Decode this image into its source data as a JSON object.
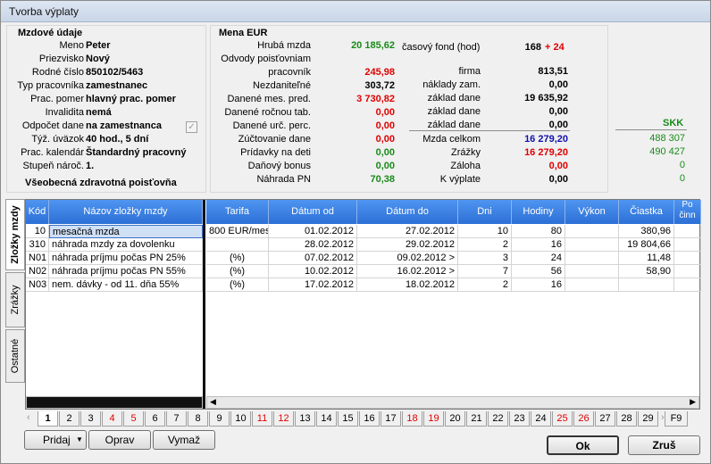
{
  "window": {
    "title": "Tvorba výplaty"
  },
  "employee": {
    "section_title": "Mzdové údaje",
    "rows": [
      {
        "label": "Meno",
        "value": "Peter"
      },
      {
        "label": "Priezvisko",
        "value": "Nový"
      },
      {
        "label": "Rodné číslo",
        "value": "850102/5463"
      },
      {
        "label": "Typ pracovníka",
        "value": "zamestnanec"
      },
      {
        "label": "Prac. pomer",
        "value": "hlavný prac. pomer"
      },
      {
        "label": "Invalidita",
        "value": "nemá"
      },
      {
        "label": "Odpočet dane",
        "value": "na zamestnanca"
      },
      {
        "label": "Týž. úväzok",
        "value": "40 hod., 5 dní"
      },
      {
        "label": "Prac. kalendár",
        "value": "Štandardný pracovný"
      },
      {
        "label": "Stupeň nároč.",
        "value": "1."
      }
    ],
    "insurance": "Všeobecná zdravotná poisťovňa",
    "deduction_checked": "✓"
  },
  "summary": {
    "section_title": "Mena EUR",
    "left": [
      {
        "label": "Hrubá mzda",
        "value": "20 185,62",
        "color": "#1a8a1a"
      },
      {
        "label": "Odvody poisťovniam",
        "value": ""
      },
      {
        "label": "pracovník",
        "value": "245,98",
        "color": "#e00000"
      },
      {
        "label": "Nezdaniteľné",
        "value": "303,72",
        "color": "#000000"
      },
      {
        "label": "Danené mes. pred.",
        "value": "3 730,82",
        "color": "#e00000"
      },
      {
        "label": "Danené ročnou tab.",
        "value": "0,00",
        "color": "#e00000"
      },
      {
        "label": "Danené urč. perc.",
        "value": "0,00",
        "color": "#e00000"
      },
      {
        "label": "Zúčtovanie dane",
        "value": "0,00",
        "color": "#e00000"
      },
      {
        "label": "Prídavky na deti",
        "value": "0,00",
        "color": "#1a8a1a"
      },
      {
        "label": "Daňový bonus",
        "value": "0,00",
        "color": "#1a8a1a"
      },
      {
        "label": "Náhrada PN",
        "value": "70,38",
        "color": "#1a8a1a"
      }
    ],
    "time_fund_label": "časový fond (hod)",
    "time_fund_value": "168",
    "time_fund_extra": "+ 24",
    "right": [
      {
        "label": "firma",
        "value": "813,51",
        "color": "#000000"
      },
      {
        "label": "náklady zam.",
        "value": "0,00",
        "color": "#000000"
      },
      {
        "label": "základ dane",
        "value": "19 635,92",
        "color": "#000000"
      },
      {
        "label": "základ dane",
        "value": "0,00",
        "color": "#000000"
      },
      {
        "label": "základ dane",
        "value": "0,00",
        "color": "#000000"
      },
      {
        "label": "Mzda celkom",
        "value": "16 279,20",
        "color": "#1010b0"
      },
      {
        "label": "Zrážky",
        "value": "16 279,20",
        "color": "#e00000"
      },
      {
        "label": "Záloha",
        "value": "0,00",
        "color": "#e00000"
      },
      {
        "label": "K výplate",
        "value": "0,00",
        "color": "#000000"
      }
    ],
    "skk": {
      "label": "SKK",
      "values": [
        "488 307",
        "490 427",
        "0",
        "0"
      ]
    }
  },
  "grid": {
    "headers": [
      "Kód",
      "Názov zložky mzdy",
      "Tarifa",
      "Dátum od",
      "Dátum do",
      "Dni",
      "Hodiny",
      "Výkon",
      "Čiastka",
      "Po činn"
    ],
    "rows": [
      {
        "kod": "10",
        "nazov": "mesačná mzda",
        "tarifa": "800 EUR/mes.",
        "od": "01.02.2012",
        "do": "27.02.2012",
        "dni": "10",
        "hodiny": "80",
        "vykon": "",
        "ciastka": "380,96"
      },
      {
        "kod": "310",
        "nazov": "náhrada mzdy za dovolenku",
        "tarifa": "",
        "od": "28.02.2012",
        "do": "29.02.2012",
        "dni": "2",
        "hodiny": "16",
        "vykon": "",
        "ciastka": "19 804,66"
      },
      {
        "kod": "N01",
        "nazov": "náhrada príjmu počas PN 25%",
        "tarifa": "(%)",
        "od": "07.02.2012",
        "do": "09.02.2012 >",
        "dni": "3",
        "hodiny": "24",
        "vykon": "",
        "ciastka": "11,48"
      },
      {
        "kod": "N02",
        "nazov": "náhrada príjmu počas PN 55%",
        "tarifa": "(%)",
        "od": "10.02.2012",
        "do": "16.02.2012 >",
        "dni": "7",
        "hodiny": "56",
        "vykon": "",
        "ciastka": "58,90"
      },
      {
        "kod": "N03",
        "nazov": "nem. dávky - od 11. dňa 55%",
        "tarifa": "(%)",
        "od": "17.02.2012",
        "do": "18.02.2012",
        "dni": "2",
        "hodiny": "16",
        "vykon": "",
        "ciastka": ""
      }
    ]
  },
  "side_tabs": [
    "Zložky mzdy",
    "Zrážky",
    "Ostatné"
  ],
  "day_tabs": [
    {
      "label": "1",
      "weekend": false
    },
    {
      "label": "2",
      "weekend": false
    },
    {
      "label": "3",
      "weekend": false
    },
    {
      "label": "4",
      "weekend": true
    },
    {
      "label": "5",
      "weekend": true
    },
    {
      "label": "6",
      "weekend": false
    },
    {
      "label": "7",
      "weekend": false
    },
    {
      "label": "8",
      "weekend": false
    },
    {
      "label": "9",
      "weekend": false
    },
    {
      "label": "10",
      "weekend": false
    },
    {
      "label": "11",
      "weekend": true
    },
    {
      "label": "12",
      "weekend": true
    },
    {
      "label": "13",
      "weekend": false
    },
    {
      "label": "14",
      "weekend": false
    },
    {
      "label": "15",
      "weekend": false
    },
    {
      "label": "16",
      "weekend": false
    },
    {
      "label": "17",
      "weekend": false
    },
    {
      "label": "18",
      "weekend": true
    },
    {
      "label": "19",
      "weekend": true
    },
    {
      "label": "20",
      "weekend": false
    },
    {
      "label": "21",
      "weekend": false
    },
    {
      "label": "22",
      "weekend": false
    },
    {
      "label": "23",
      "weekend": false
    },
    {
      "label": "24",
      "weekend": false
    },
    {
      "label": "25",
      "weekend": true
    },
    {
      "label": "26",
      "weekend": true
    },
    {
      "label": "27",
      "weekend": false
    },
    {
      "label": "28",
      "weekend": false
    },
    {
      "label": "29",
      "weekend": false
    },
    {
      "label": "F9",
      "weekend": false
    }
  ],
  "buttons": {
    "add": "Pridaj",
    "edit": "Oprav",
    "delete": "Vymaž",
    "ok": "Ok",
    "cancel": "Zruš"
  }
}
